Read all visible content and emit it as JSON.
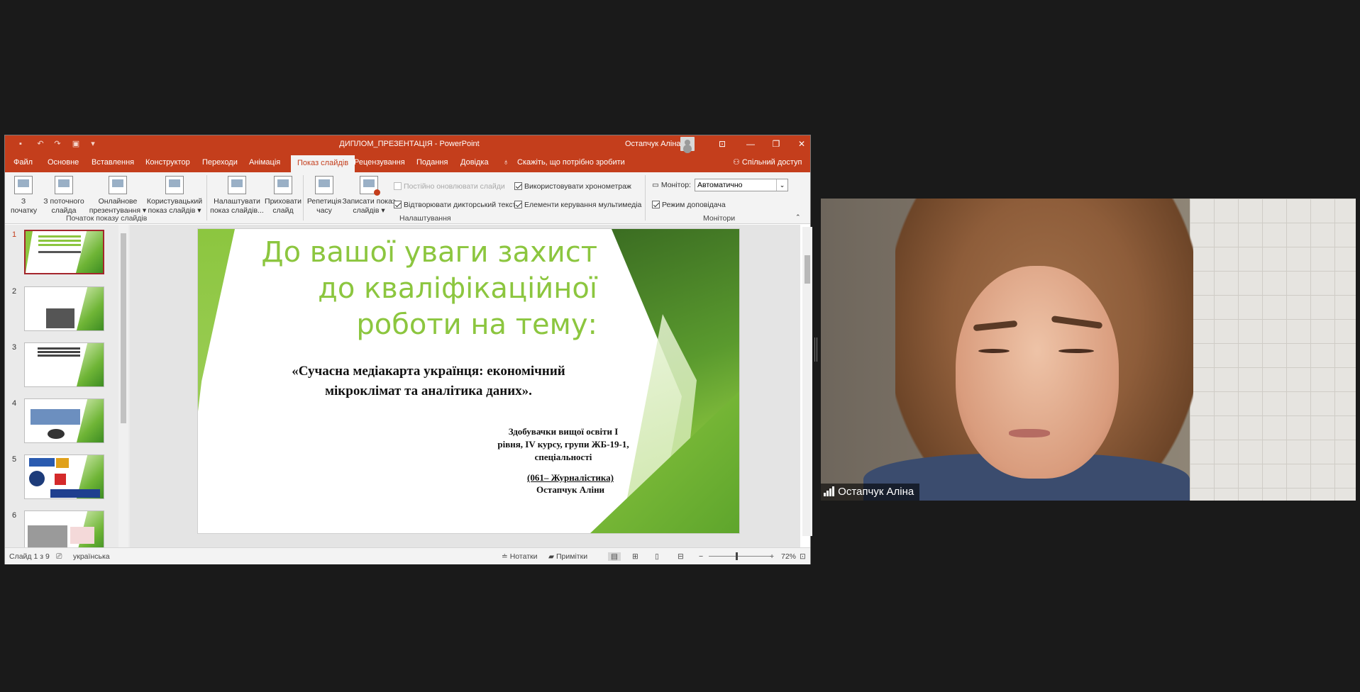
{
  "window": {
    "title": "ДИПЛОМ_ПРЕЗЕНТАЦІЯ - PowerPoint",
    "user": "Остапчук Аліна",
    "controls": {
      "minimize": "—",
      "maximize": "❐",
      "close": "✕"
    }
  },
  "tabs": [
    "Файл",
    "Основне",
    "Вставлення",
    "Конструктор",
    "Переходи",
    "Анімація",
    "Показ слайдів",
    "Рецензування",
    "Подання",
    "Довідка"
  ],
  "tell_me": "Скажіть, що потрібно зробити",
  "share": "Спільний доступ",
  "ribbon": {
    "buttons": {
      "from_start": [
        "З",
        "початку"
      ],
      "from_current": [
        "З поточного",
        "слайда"
      ],
      "online": [
        "Онлайнове",
        "презентування ▾"
      ],
      "custom": [
        "Користувацький",
        "показ слайдів ▾"
      ],
      "setup": [
        "Налаштувати",
        "показ слайдів..."
      ],
      "hide": [
        "Приховати",
        "слайд"
      ],
      "rehearse": [
        "Репетиція",
        "часу"
      ],
      "record": [
        "Записати показ",
        "слайдів ▾"
      ]
    },
    "checkboxes": {
      "keep_updated": "Постійно оновлювати слайди",
      "play_narration": "Відтворювати дикторський текст",
      "use_timings": "Використовувати хронометраж",
      "media_controls": "Елементи керування мультимедіа",
      "presenter_view": "Режим доповідача"
    },
    "monitor_label": "Монітор:",
    "monitor_value": "Автоматично",
    "groups": {
      "start": "Початок показу слайдів",
      "setup": "Налаштування",
      "monitors": "Монітори"
    }
  },
  "thumbnails": [
    "1",
    "2",
    "3",
    "4",
    "5",
    "6"
  ],
  "slide": {
    "title": "До вашої уваги захист до кваліфікаційної роботи на тему:",
    "subtitle": "«Сучасна медіакарта українця: економічний мікроклімат та аналітика даних».",
    "author": "Здобувачки вищої освіти I рівня, IV курсу, групи ЖБ-19-1, спеціальності",
    "spec_code": "(061– Журналістика)",
    "spec_name": "Остапчук Аліни"
  },
  "status": {
    "slide_count": "Слайд 1 з 9",
    "language": "українська",
    "notes": "Нотатки",
    "comments": "Примітки",
    "zoom": "72%"
  },
  "video": {
    "participant": "Остапчук Аліна"
  }
}
